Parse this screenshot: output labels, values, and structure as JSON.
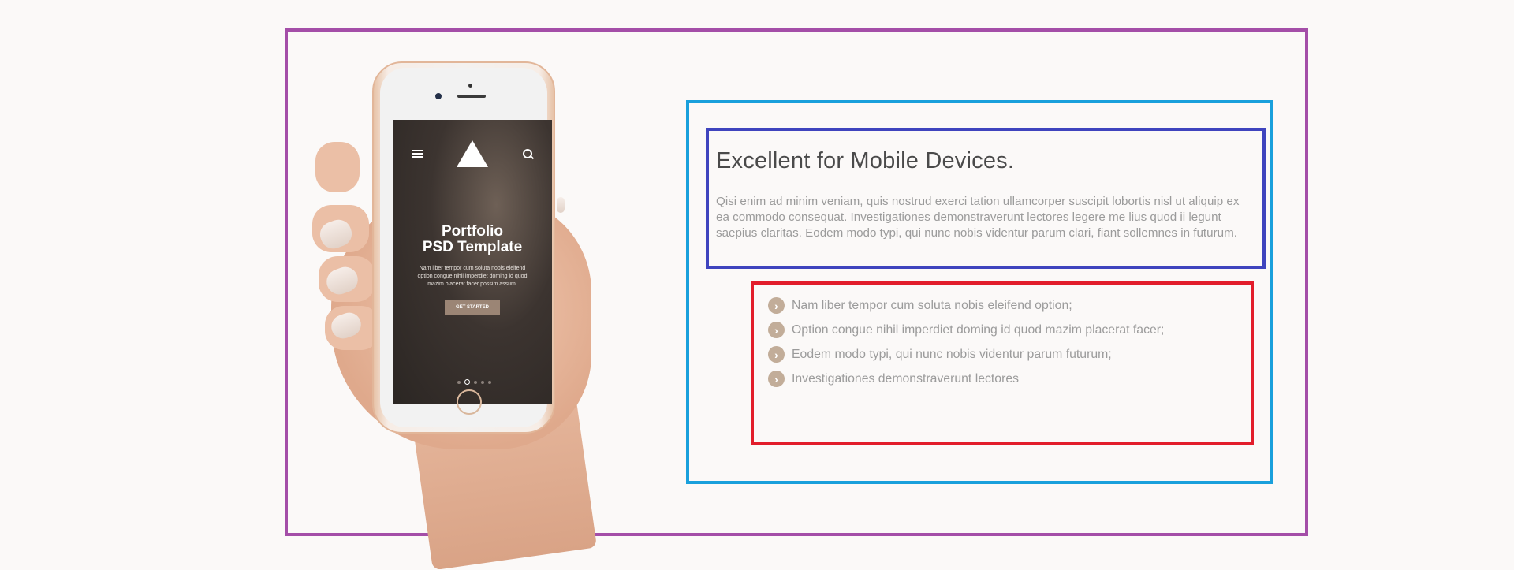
{
  "phone_screen": {
    "title_line1": "Portfolio",
    "title_line2": "PSD Template",
    "description": "Nam liber tempor cum soluta nobis eleifend option congue nihil imperdiet doming id quod mazim placerat facer possim assum.",
    "button_label": "GET STARTED"
  },
  "content": {
    "headline": "Excellent for Mobile Devices.",
    "lead": "Qisi enim ad minim veniam, quis nostrud exerci tation ullamcorper suscipit lobortis nisl ut aliquip ex ea commodo consequat. Investigationes demonstraverunt lectores legere me lius quod ii legunt saepius claritas. Eodem modo typi, qui nunc nobis videntur parum clari, fiant sollemnes in futurum.",
    "features": [
      "Nam liber tempor cum soluta nobis eleifend option;",
      "Option congue nihil imperdiet doming id quod mazim placerat facer;",
      "Eodem modo typi, qui nunc nobis videntur parum futurum;",
      "Investigationes demonstraverunt lectores"
    ]
  },
  "colors": {
    "outer_frame": "#a44ea8",
    "content_frame": "#1aa0dc",
    "heading_frame": "#3f44be",
    "list_frame": "#e21d2b",
    "bullet": "#c2ad99"
  },
  "icons": {
    "bullet": "chevron-right-icon",
    "menu": "hamburger-menu-icon",
    "search": "search-icon",
    "logo": "triangle-logo-icon"
  }
}
